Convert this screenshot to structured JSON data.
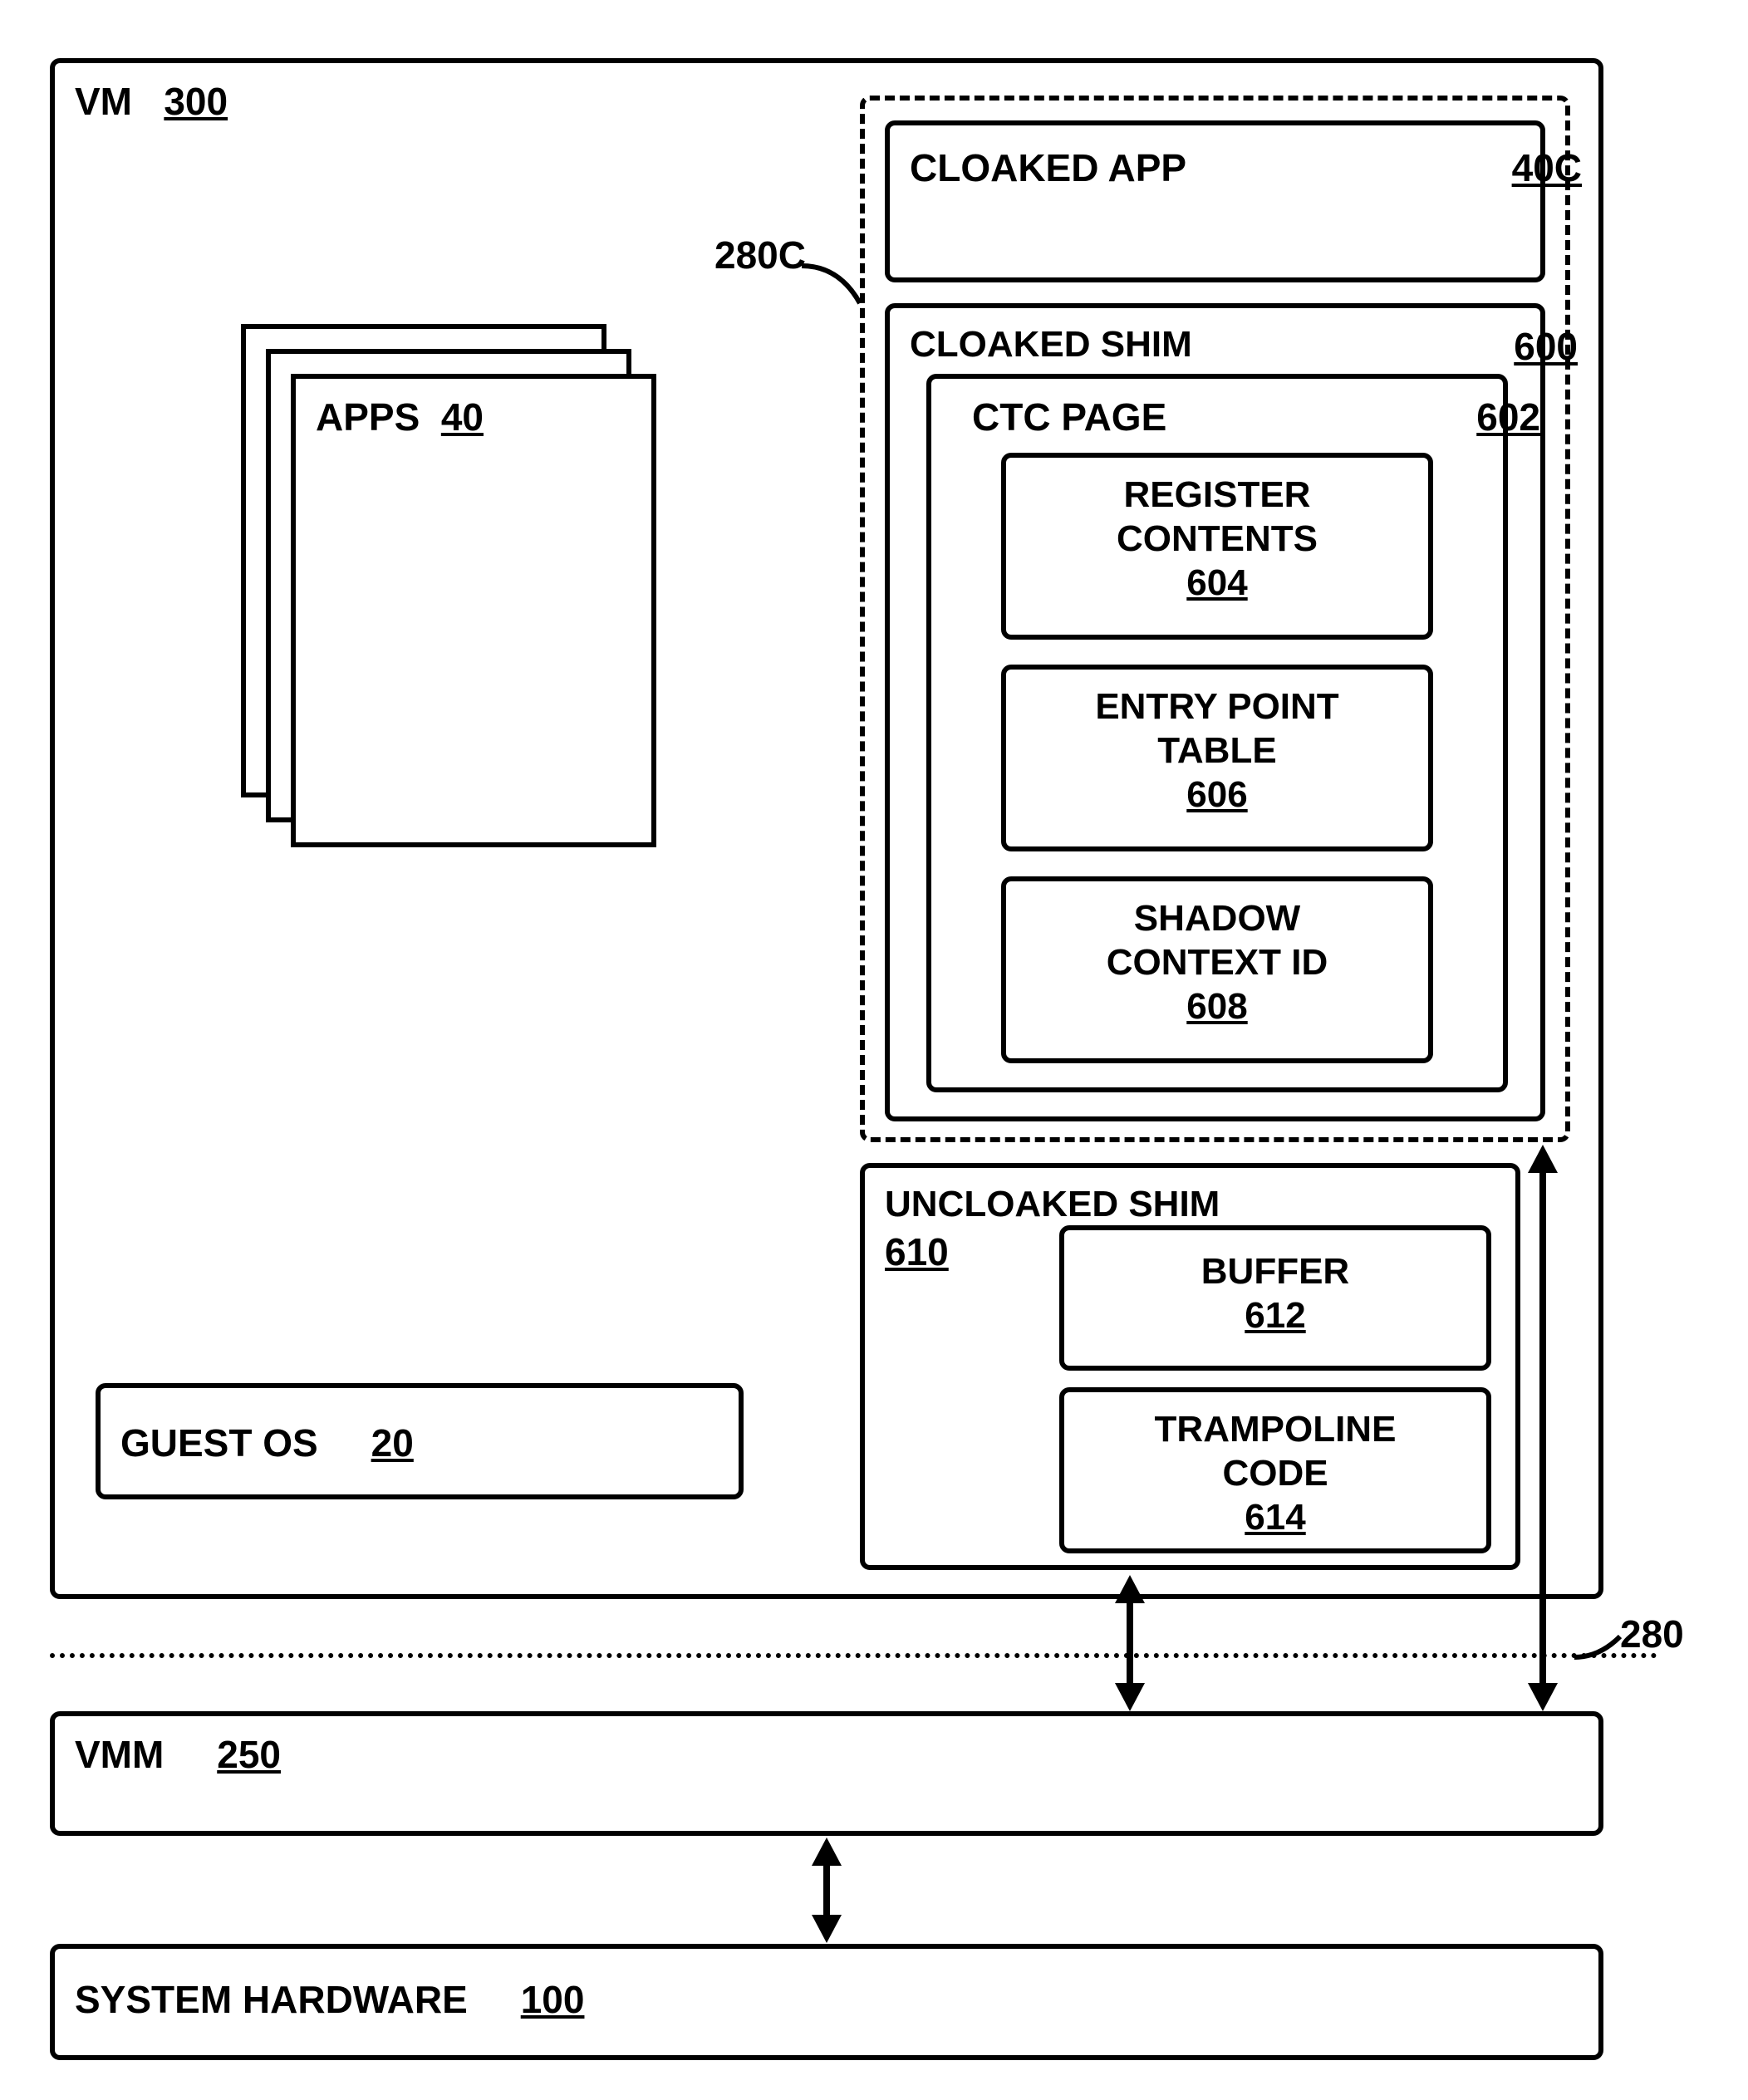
{
  "vm": {
    "label": "VM",
    "ref": "300"
  },
  "apps": {
    "label": "APPS",
    "ref": "40"
  },
  "guest_os": {
    "label": "GUEST OS",
    "ref": "20"
  },
  "callout_280c": "280C",
  "cloaked_app": {
    "label": "CLOAKED APP",
    "ref": "40C"
  },
  "cloaked_shim": {
    "label": "CLOAKED SHIM",
    "ref": "600"
  },
  "ctc_page": {
    "label": "CTC PAGE",
    "ref": "602"
  },
  "register_contents": {
    "label": "REGISTER CONTENTS",
    "ref": "604"
  },
  "entry_point_table": {
    "label": "ENTRY POINT TABLE",
    "ref": "606"
  },
  "shadow_context_id": {
    "label": "SHADOW CONTEXT ID",
    "ref": "608"
  },
  "uncloaked_shim": {
    "label": "UNCLOAKED SHIM",
    "ref": "610"
  },
  "buffer": {
    "label": "BUFFER",
    "ref": "612"
  },
  "trampoline_code": {
    "label": "TRAMPOLINE CODE",
    "ref": "614"
  },
  "callout_280": "280",
  "vmm": {
    "label": "VMM",
    "ref": "250"
  },
  "system_hardware": {
    "label": "SYSTEM HARDWARE",
    "ref": "100"
  }
}
